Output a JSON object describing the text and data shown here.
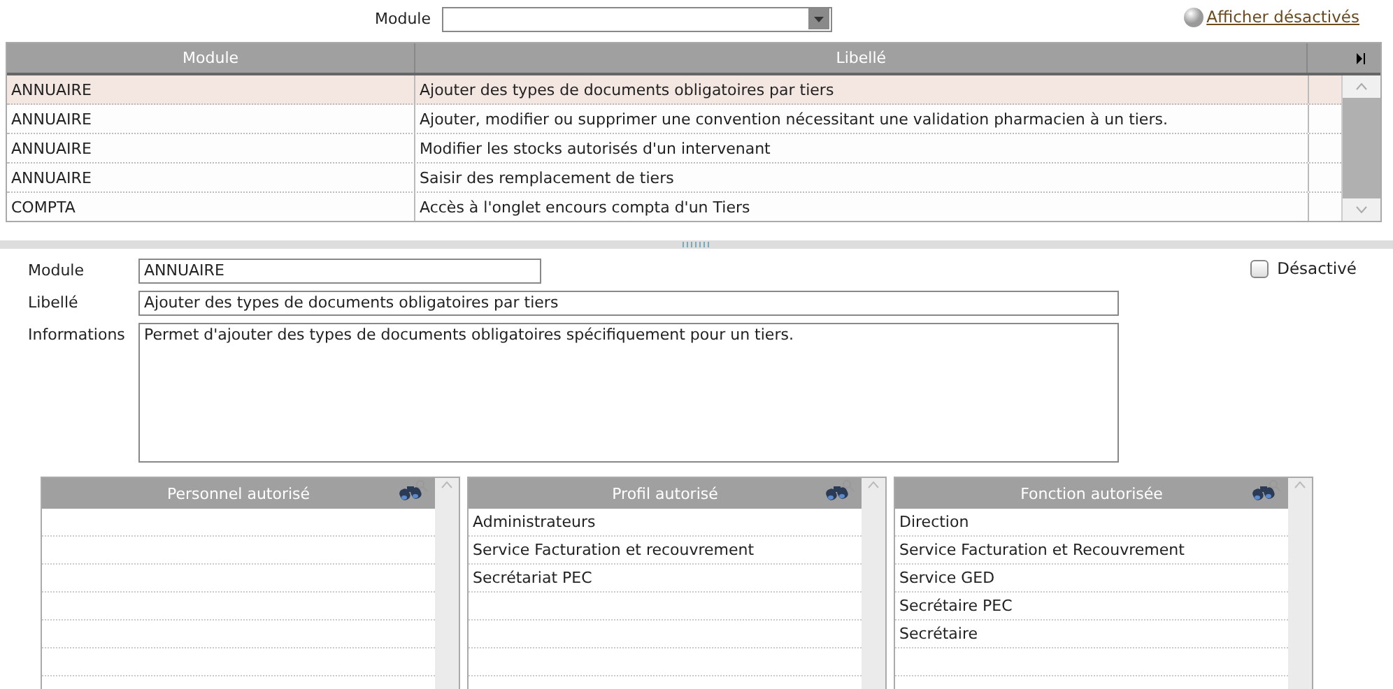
{
  "filter": {
    "label": "Module"
  },
  "show_disabled_link": {
    "label": "Afficher désactivés",
    "on": false
  },
  "table": {
    "columns": [
      "Module",
      "Libellé"
    ],
    "rows": [
      {
        "module": "ANNUAIRE",
        "libelle": "Ajouter des types de documents obligatoires par tiers",
        "selected": true
      },
      {
        "module": "ANNUAIRE",
        "libelle": "Ajouter, modifier ou supprimer une convention nécessitant une validation pharmacien à un tiers.",
        "selected": false
      },
      {
        "module": "ANNUAIRE",
        "libelle": "Modifier les stocks autorisés d'un intervenant",
        "selected": false
      },
      {
        "module": "ANNUAIRE",
        "libelle": "Saisir des remplacement de tiers",
        "selected": false
      },
      {
        "module": "COMPTA",
        "libelle": "Accès à l'onglet encours compta d'un Tiers",
        "selected": false
      }
    ]
  },
  "form": {
    "module": {
      "label": "Module",
      "value": "ANNUAIRE"
    },
    "libelle": {
      "label": "Libellé",
      "value": "Ajouter des types de documents obligatoires par tiers"
    },
    "informations": {
      "label": "Informations",
      "value": "Permet d'ajouter des types de documents obligatoires spécifiquement pour un tiers."
    },
    "disabled": {
      "label": "Désactivé",
      "checked": false
    }
  },
  "lists": [
    {
      "title": "Personnel autorisé"
    },
    {
      "title": "Profil autorisé",
      "items": [
        "Administrateurs",
        "Service Facturation et recouvrement",
        "Secrétariat PEC"
      ]
    },
    {
      "title": "Fonction autorisée",
      "items": [
        "Direction",
        "Service Facturation et Recouvrement",
        "Service GED",
        "Secrétaire PEC",
        "Secrétaire"
      ]
    }
  ]
}
